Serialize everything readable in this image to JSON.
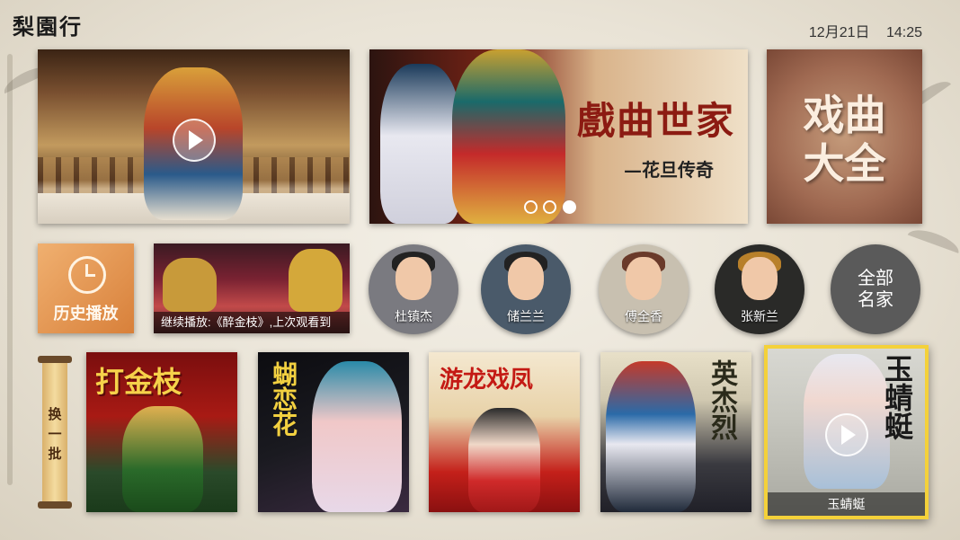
{
  "header": {
    "logo": "梨園行",
    "date": "12月21日",
    "time": "14:25"
  },
  "top_row": {
    "banner": {
      "title": "戲曲世家",
      "subtitle": "—花旦传奇",
      "slide_count": 3,
      "active_slide": 3
    },
    "opera_all": {
      "label": "戏曲大全"
    }
  },
  "second_row": {
    "history": {
      "label": "历史播放"
    },
    "continue": {
      "text": "继续播放:《醉金枝》,上次观看到"
    },
    "artists": [
      {
        "name": "杜镇杰"
      },
      {
        "name": "储兰兰"
      },
      {
        "name": "傅全香"
      },
      {
        "name": "张新兰"
      }
    ],
    "all_artists": {
      "line1": "全部",
      "line2": "名家"
    }
  },
  "third_row": {
    "refresh": {
      "label": "换一批"
    },
    "posters": [
      {
        "title": "打金枝"
      },
      {
        "title": "蝴恋花"
      },
      {
        "title": "游龙戏凤"
      },
      {
        "title": "英杰烈"
      },
      {
        "title": "玉蜻蜓",
        "caption": "玉蜻蜓"
      }
    ]
  },
  "colors": {
    "accent_focus": "#f4d13a",
    "banner_title": "#8c1b12"
  }
}
